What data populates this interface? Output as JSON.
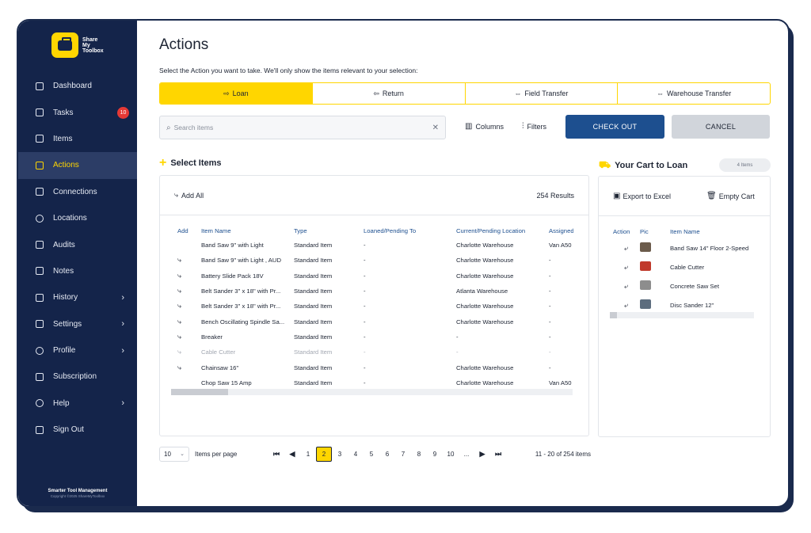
{
  "sidebar": {
    "logo_text": "Share My Toolbox",
    "items": [
      {
        "label": "Dashboard",
        "icon": "grid-icon"
      },
      {
        "label": "Tasks",
        "icon": "check-square-icon",
        "badge": "10"
      },
      {
        "label": "Items",
        "icon": "toolbox-icon"
      },
      {
        "label": "Actions",
        "icon": "actions-icon",
        "active": true
      },
      {
        "label": "Connections",
        "icon": "people-icon"
      },
      {
        "label": "Locations",
        "icon": "location-pin-icon"
      },
      {
        "label": "Audits",
        "icon": "clipboard-icon"
      },
      {
        "label": "Notes",
        "icon": "notes-icon"
      },
      {
        "label": "History",
        "icon": "history-icon",
        "chevron": true
      },
      {
        "label": "Settings",
        "icon": "gear-icon",
        "chevron": true
      },
      {
        "label": "Profile",
        "icon": "user-icon",
        "chevron": true
      },
      {
        "label": "Subscription",
        "icon": "subscription-icon"
      },
      {
        "label": "Help",
        "icon": "help-icon",
        "chevron": true
      },
      {
        "label": "Sign Out",
        "icon": "sign-out-icon"
      }
    ],
    "footer_title": "Smarter Tool Management",
    "footer_copy": "Copyright ©2025 ShareMyToolbox"
  },
  "main": {
    "title": "Actions",
    "subtitle": "Select the Action you want to take. We'll only show the items relevant to your selection:",
    "action_tabs": [
      {
        "label": "Loan",
        "glyph": "⇨",
        "active": true
      },
      {
        "label": "Return",
        "glyph": "⇦"
      },
      {
        "label": "Field Transfer",
        "glyph": "⇔"
      },
      {
        "label": "Warehouse Transfer",
        "glyph": "⇔"
      }
    ],
    "search": {
      "placeholder": "Search items",
      "value": ""
    },
    "columns_label": "Columns",
    "filters_label": "Filters",
    "checkout_label": "CHECK OUT",
    "cancel_label": "CANCEL"
  },
  "select_items": {
    "title": "Select Items",
    "add_all": "Add All",
    "results": "254 Results",
    "columns": [
      "Add",
      "Item Name",
      "Type",
      "Loaned/Pending To",
      "Current/Pending Location",
      "Assigned"
    ],
    "rows": [
      {
        "add": "",
        "name": "Band Saw 9\" with Light",
        "type": "Standard Item",
        "loaned": "-",
        "location": "Charlotte Warehouse",
        "assigned": "Van A50"
      },
      {
        "add": "⤷",
        "name": "Band Saw 9\" with Light , AUD",
        "type": "Standard Item",
        "loaned": "-",
        "location": "Charlotte Warehouse",
        "assigned": "-"
      },
      {
        "add": "⤷",
        "name": "Battery Slide Pack 18V",
        "type": "Standard Item",
        "loaned": "-",
        "location": "Charlotte Warehouse",
        "assigned": "-"
      },
      {
        "add": "⤷",
        "name": "Belt Sander 3\" x 18\" with Pr...",
        "type": "Standard Item",
        "loaned": "-",
        "location": "Atlanta Warehouse",
        "assigned": "-"
      },
      {
        "add": "⤷",
        "name": "Belt Sander 3\" x 18\" with Pr...",
        "type": "Standard Item",
        "loaned": "-",
        "location": "Charlotte Warehouse",
        "assigned": "-"
      },
      {
        "add": "⤷",
        "name": "Bench Oscillating Spindle Sa...",
        "type": "Standard Item",
        "loaned": "-",
        "location": "Charlotte Warehouse",
        "assigned": "-"
      },
      {
        "add": "⤷",
        "name": "Breaker",
        "type": "Standard Item",
        "loaned": "-",
        "location": "-",
        "assigned": "-"
      },
      {
        "add": "⤷",
        "name": "Cable Cutter",
        "type": "Standard Item",
        "loaned": "-",
        "location": "-",
        "assigned": "-",
        "dim": true
      },
      {
        "add": "⤷",
        "name": "Chainsaw 16\"",
        "type": "Standard Item",
        "loaned": "-",
        "location": "Charlotte Warehouse",
        "assigned": "-"
      },
      {
        "add": "",
        "name": "Chop Saw 15 Amp",
        "type": "Standard Item",
        "loaned": "-",
        "location": "Charlotte Warehouse",
        "assigned": "Van A50"
      }
    ]
  },
  "pagination": {
    "per_page": "10",
    "per_page_label": "Items per page",
    "pages": [
      "1",
      "2",
      "3",
      "4",
      "5",
      "6",
      "7",
      "8",
      "9",
      "10"
    ],
    "current": "2",
    "ellipsis": "...",
    "range": "11 - 20 of 254 items"
  },
  "cart": {
    "title": "Your Cart to Loan",
    "count": "4 Items",
    "export": "Export to Excel",
    "empty": "Empty Cart",
    "columns": [
      "Action",
      "Pic",
      "Item Name"
    ],
    "rows": [
      {
        "name": "Band Saw 14\" Floor 2-Speed",
        "pic": "band-saw-image"
      },
      {
        "name": "Cable Cutter",
        "pic": "cable-cutter-image"
      },
      {
        "name": "Concrete Saw Set",
        "pic": "concrete-saw-image"
      },
      {
        "name": "Disc Sander 12\"",
        "pic": "disc-sander-image"
      }
    ]
  },
  "colors": {
    "accent": "#ffd600",
    "navy": "#14244a",
    "button_blue": "#1d4f8f",
    "badge_red": "#e53935"
  }
}
